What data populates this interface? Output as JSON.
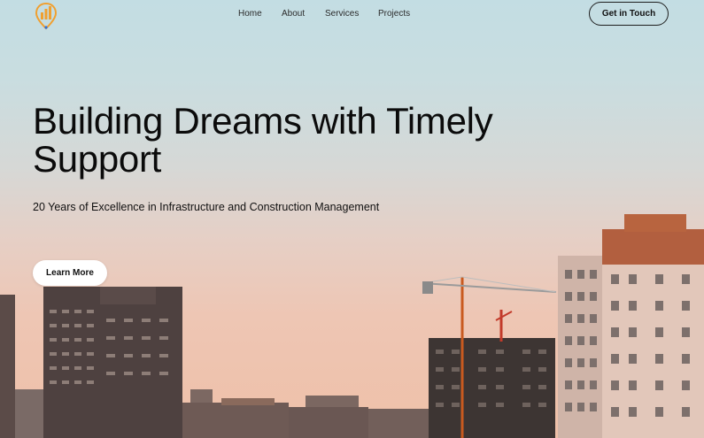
{
  "nav": {
    "items": [
      {
        "label": "Home"
      },
      {
        "label": "About"
      },
      {
        "label": "Services"
      },
      {
        "label": "Projects"
      }
    ],
    "cta_label": "Get in Touch"
  },
  "hero": {
    "headline": "Building Dreams with Timely Support",
    "subheadline": "20 Years of Excellence in Infrastructure and Construction Management",
    "button_label": "Learn More"
  },
  "colors": {
    "logo_orange": "#f0a030",
    "logo_blue": "#2e6fd8",
    "sky_top": "#c3dde3",
    "sky_bottom": "#efc0a8"
  },
  "icons": {
    "logo": "bar-chart-pin-logo"
  }
}
